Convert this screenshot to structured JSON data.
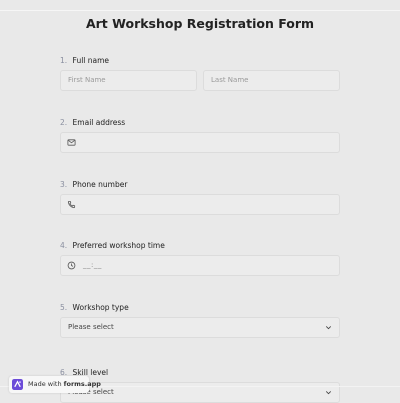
{
  "form": {
    "title": "Art Workshop Registration Form",
    "questions": [
      {
        "number": "1.",
        "label": "Full name",
        "first_placeholder": "First Name",
        "last_placeholder": "Last Name"
      },
      {
        "number": "2.",
        "label": "Email address",
        "icon": "envelope-icon"
      },
      {
        "number": "3.",
        "label": "Phone number",
        "icon": "phone-icon"
      },
      {
        "number": "4.",
        "label": "Preferred workshop time",
        "icon": "clock-icon",
        "placeholder": "__:__"
      },
      {
        "number": "5.",
        "label": "Workshop type",
        "selected": "Please select"
      },
      {
        "number": "6.",
        "label": "Skill level",
        "selected": "Please select"
      }
    ]
  },
  "footer": {
    "prefix": "Made with",
    "brand": "forms.app"
  }
}
